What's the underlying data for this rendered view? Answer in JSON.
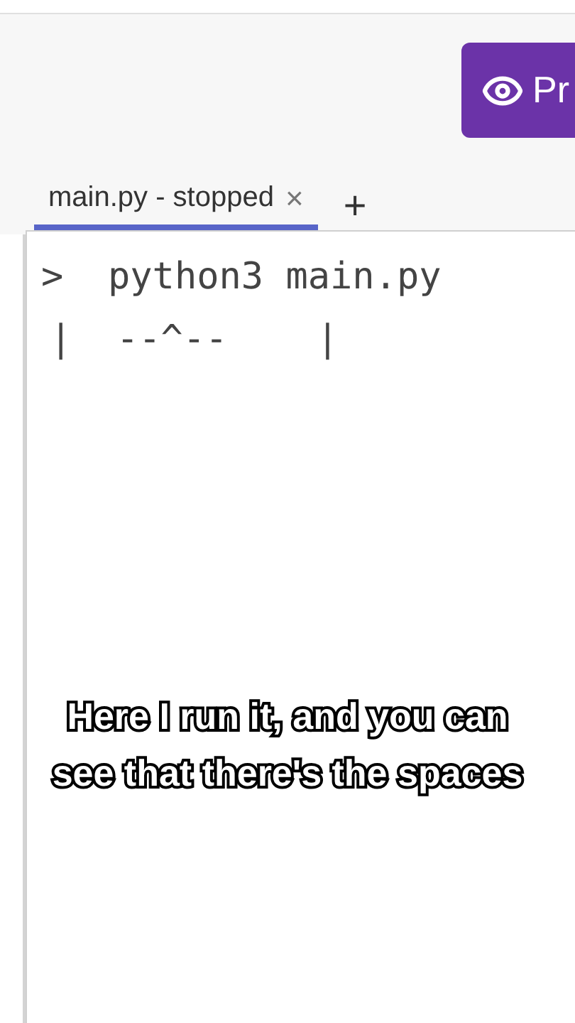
{
  "header": {
    "button": "Pr"
  },
  "tabs": [
    {
      "label": "main.py - stopped",
      "close": "×",
      "selected": true
    }
  ],
  "add_tab": "+",
  "console": {
    "lines": [
      {
        "prompt": ">",
        "text": "python3 main.py"
      },
      {
        "text": "|  --^--    |"
      }
    ]
  },
  "caption": "Here I run it, and you can see that there's the spaces"
}
